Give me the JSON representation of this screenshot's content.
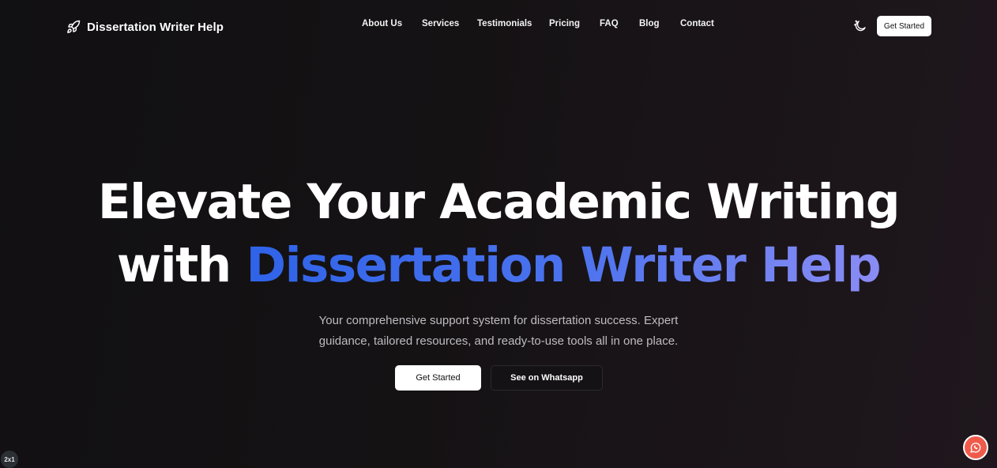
{
  "brand": {
    "name": "Dissertation Writer Help",
    "icon": "rocket-icon"
  },
  "nav": {
    "links": [
      "About Us",
      "Services",
      "Testimonials",
      "Pricing",
      "FAQ",
      "Blog",
      "Contact"
    ],
    "theme_icon": "moon-stars-icon",
    "cta_label": "Get Started"
  },
  "hero": {
    "title_line1": "Elevate Your Academic Writing",
    "title_line2_plain": "with ",
    "title_line2_highlight": "Dissertation Writer Help",
    "subtitle_line1": "Your comprehensive support system for dissertation success. Expert",
    "subtitle_line2": "guidance, tailored resources, and ready-to-use tools all in one place.",
    "primary_button": "Get Started",
    "secondary_button": "See on Whatsapp"
  },
  "fab": {
    "icon": "whatsapp-icon"
  },
  "corner_badge": "2x1",
  "colors": {
    "background": "#151214",
    "gradient_start": "#2f63e8",
    "gradient_end": "#8a8cf4",
    "fab": "#f05a4a"
  }
}
